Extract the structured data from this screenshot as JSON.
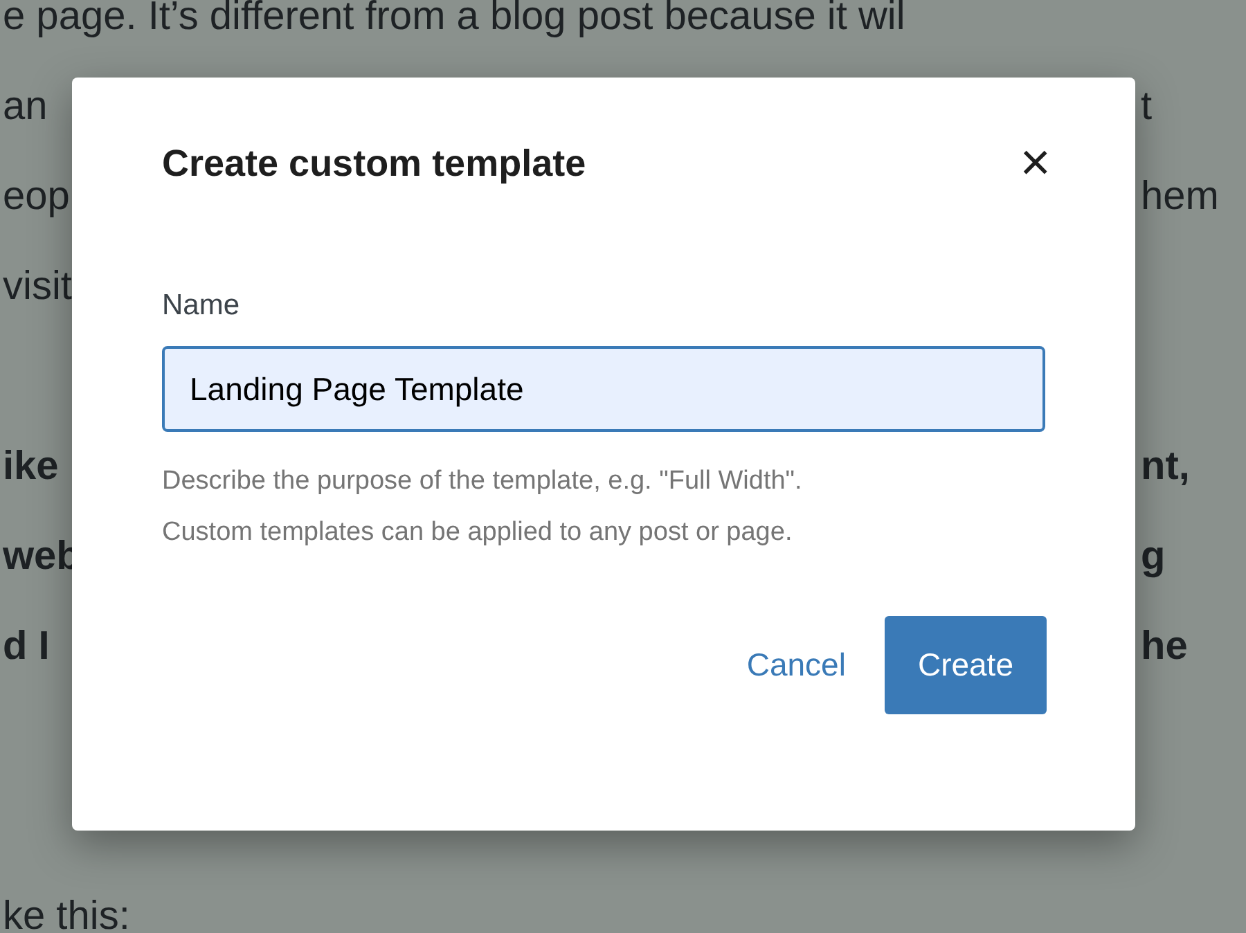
{
  "background_article": {
    "paragraphs": [
      {
        "bold": false,
        "lines": [
          {
            "left": "e page. It’s different from a blog post because it wil"
          },
          {
            "left": "an",
            "right": "t"
          },
          {
            "left": "eop",
            "right": "hem"
          },
          {
            "left": "visit"
          }
        ]
      },
      {
        "bold": true,
        "lines": [
          {
            "left": "ike",
            "right": "nt,"
          },
          {
            "left": "web",
            "right": "g"
          },
          {
            "left": "d I",
            "right": "he"
          }
        ]
      },
      {
        "bold": false,
        "lines": [
          {
            "left": "ke this:"
          }
        ]
      }
    ]
  },
  "dialog": {
    "title": "Create custom template",
    "close": "×",
    "field": {
      "label": "Name",
      "value": "Landing Page Template",
      "focused": true
    },
    "help": [
      "Describe the purpose of the template, e.g. \"Full Width\".",
      "Custom templates can be applied to any post or page."
    ],
    "buttons": [
      {
        "label": "Cancel",
        "kind": "link"
      },
      {
        "label": "Create",
        "kind": "primary"
      }
    ]
  }
}
